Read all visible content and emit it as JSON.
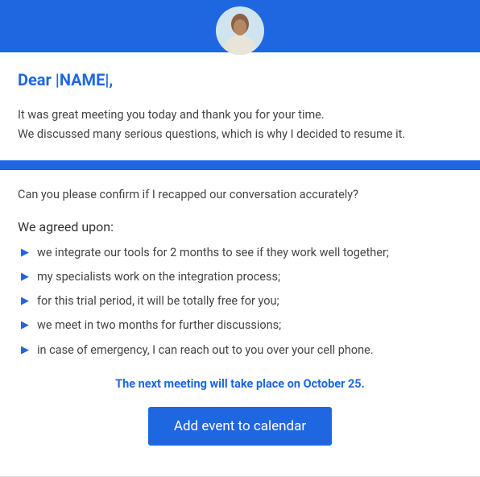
{
  "greeting": "Dear |NAME|,",
  "intro": {
    "line1": "It was great meeting you today and thank you for your time.",
    "line2": "We discussed many serious questions, which is why I decided to resume it."
  },
  "confirm_text": "Can you please confirm if I recapped our conversation accurately?",
  "agreed_heading": "We agreed upon:",
  "bullets": [
    "we integrate our tools for 2 months to see if they work well together;",
    "my specialists work on the integration process;",
    "for this trial period, it will be totally free for you;",
    "we meet in two months for further discussions;",
    "in case of emergency, I can reach out to you over your cell phone."
  ],
  "next_meeting": "The next meeting will take place on October 25.",
  "cta_label": "Add event to calendar"
}
